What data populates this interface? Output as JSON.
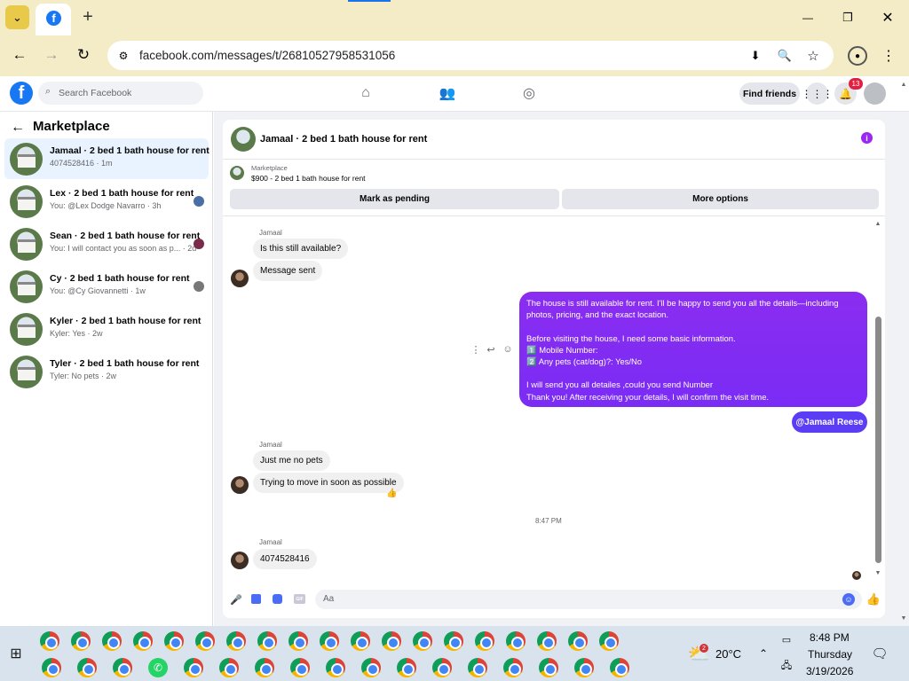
{
  "browser": {
    "url": "facebook.com/messages/t/26810527958531056",
    "new_tab": "+",
    "controls": {
      "minimize": "—",
      "maximize": "❐",
      "close": "✕"
    }
  },
  "facebook": {
    "search_placeholder": "Search Facebook",
    "find_friends": "Find friends",
    "notif_count": "13"
  },
  "sidebar": {
    "title": "Marketplace",
    "conversations": [
      {
        "title": "Jamaal · 2 bed 1 bath house for rent",
        "subtitle": "4074528416 · 1m"
      },
      {
        "title": "Lex · 2 bed 1 bath house for rent",
        "subtitle": "You: @Lex Dodge Navarro · 3h"
      },
      {
        "title": "Sean · 2 bed 1 bath house for rent",
        "subtitle": "You: I will contact you as soon as p... · 2d"
      },
      {
        "title": "Cy · 2 bed 1 bath house for rent",
        "subtitle": "You: @Cy Giovannetti · 1w"
      },
      {
        "title": "Kyler · 2 bed 1 bath house for rent",
        "subtitle": "Kyler: Yes · 2w"
      },
      {
        "title": "Tyler · 2 bed 1 bath house for rent",
        "subtitle": "Tyler: No pets · 2w"
      }
    ]
  },
  "chat": {
    "header_title": "Jamaal · 2 bed 1 bath house for rent",
    "marketplace_label": "Marketplace",
    "listing": "$900 - 2 bed 1 bath house for rent",
    "mark_pending": "Mark as pending",
    "more_options": "More options",
    "messages": {
      "sender1": "Jamaal",
      "m1": "Is this still available?",
      "m2": "Message sent",
      "own_lines": [
        "The house is still available for rent. I'll be happy to send you all the details—including",
        "photos, pricing, and the exact location.",
        "",
        "Before visiting the house, I need some basic information.",
        "1️⃣  Mobile Number:",
        "2️⃣ Any pets (cat/dog)?: Yes/No",
        "",
        "I will send you all detailes ,could you send Number",
        "Thank you! After receiving your details, I will confirm the visit time."
      ],
      "mention": "@Jamaal Reese",
      "sender2": "Jamaal",
      "m3": "Just me no pets",
      "m4": "Trying to move in soon as possible",
      "reaction": "👍",
      "time": "8:47 PM",
      "sender3": "Jamaal",
      "m5": "4074528416"
    },
    "composer_placeholder": "Aa"
  },
  "taskbar": {
    "weather_badge": "2",
    "temperature": "20°C",
    "time": "8:48 PM",
    "day": "Thursday",
    "date": "3/19/2026"
  }
}
